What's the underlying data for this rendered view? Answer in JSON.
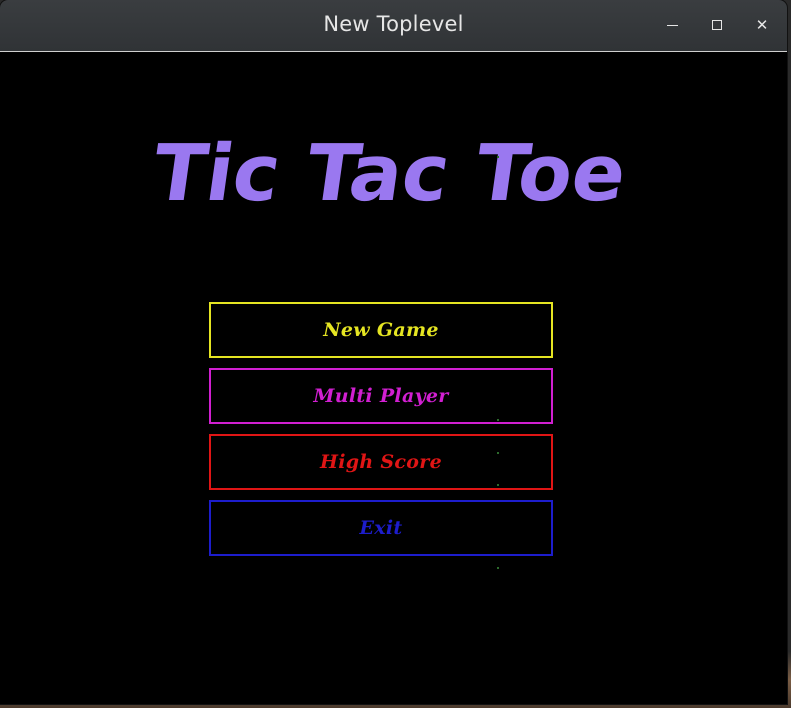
{
  "window": {
    "title": "New Toplevel",
    "controls": {
      "minimize": "minimize-icon",
      "maximize": "maximize-icon",
      "close": "close-icon"
    }
  },
  "logo": {
    "text": "Tic Tac Toe",
    "color": "#9a78f0"
  },
  "menu": [
    {
      "label": "New Game",
      "color": "#e5e522"
    },
    {
      "label": "Multi Player",
      "color": "#d11fd1"
    },
    {
      "label": "High Score",
      "color": "#e01515"
    },
    {
      "label": "Exit",
      "color": "#1d1dcc"
    }
  ]
}
